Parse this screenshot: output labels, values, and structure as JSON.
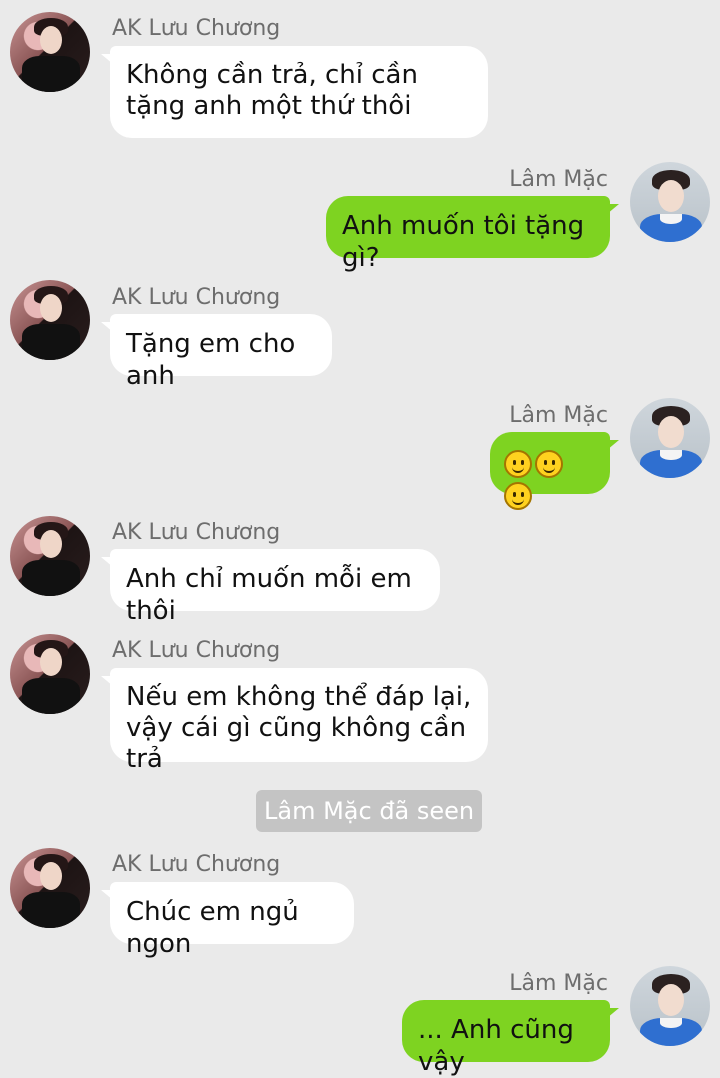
{
  "conversation": {
    "contact_name": "AK Lưu Chương",
    "self_name": "Lâm Mặc",
    "messages": [
      {
        "sender": "AK Lưu Chương",
        "text": "Không cần trả, chỉ cần tặng anh một thứ thôi"
      },
      {
        "sender": "Lâm Mặc",
        "text": "Anh muốn tôi tặng gì?"
      },
      {
        "sender": "AK Lưu Chương",
        "text": "Tặng em cho anh"
      },
      {
        "sender": "Lâm Mặc",
        "text": "🙂🙂🙂",
        "emoji_count": 3,
        "icon": "slightly-smiling-face-icon"
      },
      {
        "sender": "AK Lưu Chương",
        "text": "Anh chỉ muốn mỗi em thôi"
      },
      {
        "sender": "AK Lưu Chương",
        "text": "Nếu em không thể đáp lại, vậy cái gì cũng không cần trả"
      },
      {
        "sender": "AK Lưu Chương",
        "text": "Chúc em ngủ ngon"
      },
      {
        "sender": "Lâm Mặc",
        "text": "... Anh cũng vậy"
      }
    ],
    "seen_notice": "Lâm Mặc đã seen"
  },
  "colors": {
    "background": "#eaeaea",
    "incoming_bubble": "#ffffff",
    "outgoing_bubble": "#7ed321",
    "seen_badge": "#c4c4c4"
  }
}
